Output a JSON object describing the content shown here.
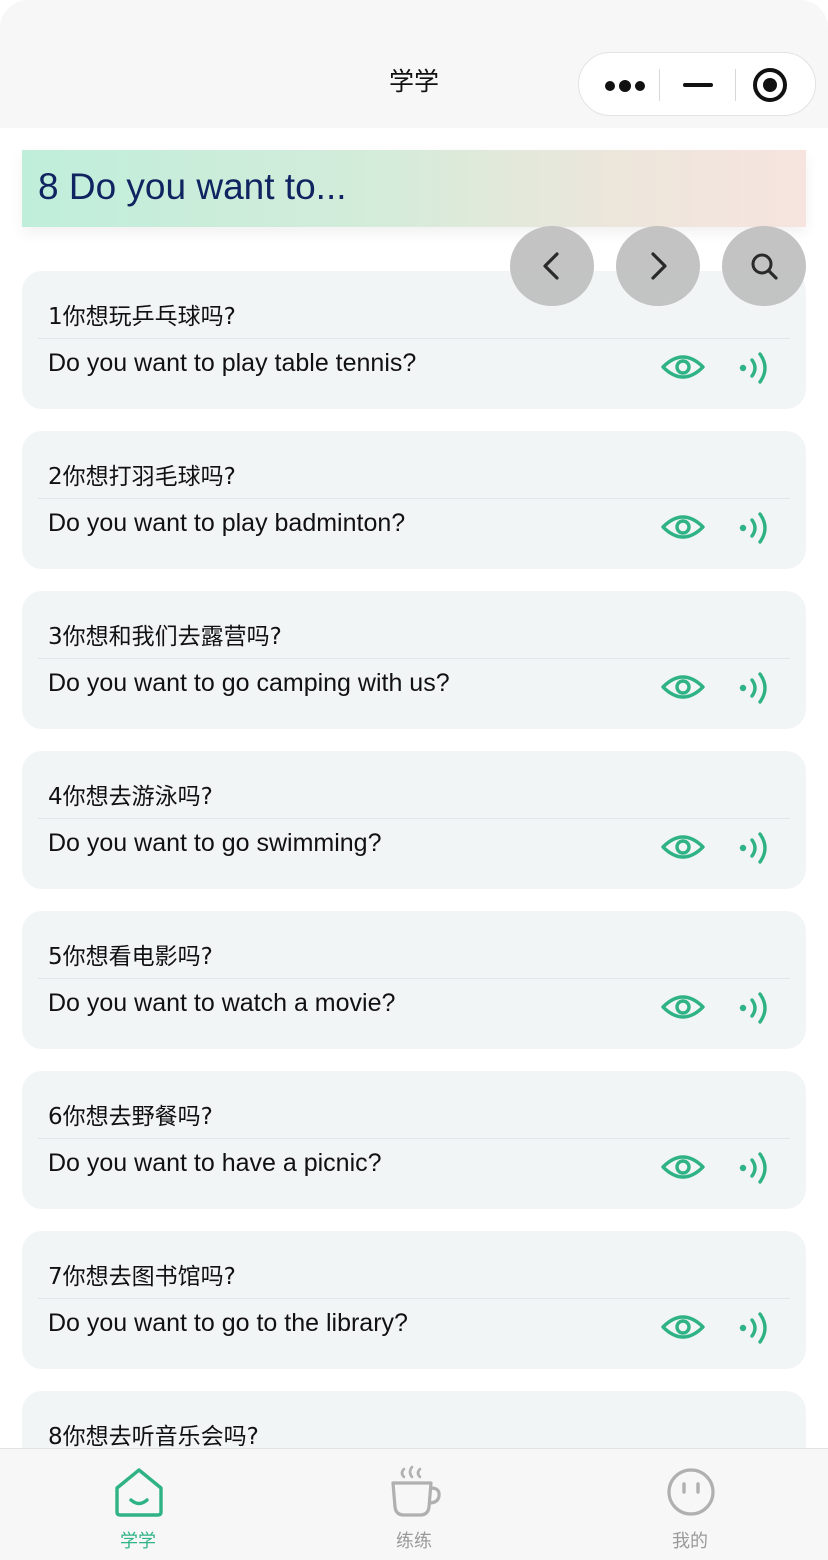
{
  "nav": {
    "title": "学学"
  },
  "lesson": {
    "title": "8 Do you want to..."
  },
  "items": [
    {
      "zh": "1你想玩乒乓球吗?",
      "en": "Do you want to play table tennis?"
    },
    {
      "zh": "2你想打羽毛球吗?",
      "en": "Do you want to play badminton?"
    },
    {
      "zh": "3你想和我们去露营吗?",
      "en": "Do you want to go camping with us?"
    },
    {
      "zh": "4你想去游泳吗?",
      "en": "Do you want to go swimming?"
    },
    {
      "zh": "5你想看电影吗?",
      "en": "Do you want to watch a movie?"
    },
    {
      "zh": "6你想去野餐吗?",
      "en": "Do you want to have a picnic?"
    },
    {
      "zh": "7你想去图书馆吗?",
      "en": "Do you want to go to the library?"
    },
    {
      "zh": "8你想去听音乐会吗?",
      "en": ""
    }
  ],
  "tabs": [
    {
      "label": "学学",
      "icon": "home-smile-icon",
      "active": true
    },
    {
      "label": "练练",
      "icon": "coffee-cup-icon",
      "active": false
    },
    {
      "label": "我的",
      "icon": "face-icon",
      "active": false
    }
  ],
  "colors": {
    "accent": "#2fb385",
    "inactive": "#b0b0b0",
    "headerText": "#0f2460"
  }
}
